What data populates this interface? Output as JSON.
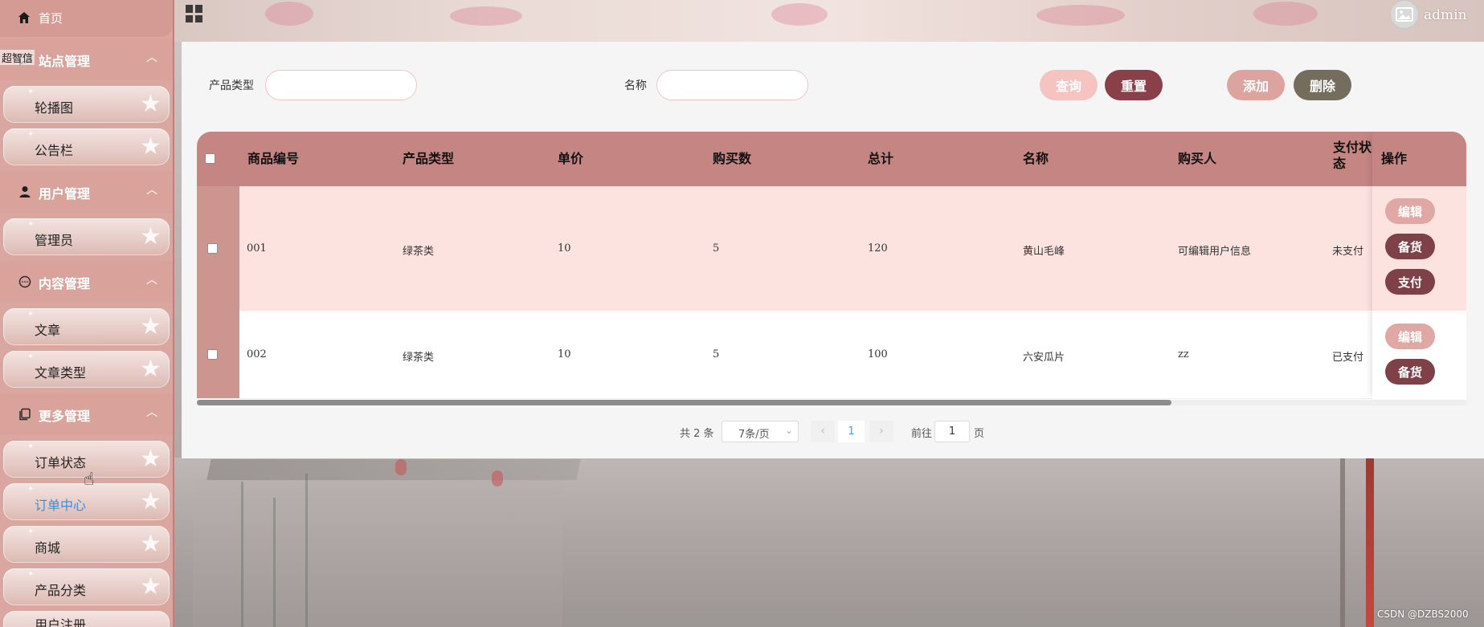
{
  "header": {
    "username": "admin"
  },
  "sidebar": {
    "home_label": "首页",
    "float_label": "超智信",
    "groups": [
      {
        "label": "站点管理",
        "icon": "chat-icon"
      },
      {
        "label": "用户管理",
        "icon": "user-icon"
      },
      {
        "label": "内容管理",
        "icon": "comment-icon"
      },
      {
        "label": "更多管理",
        "icon": "copy-icon"
      }
    ],
    "items": [
      {
        "label": "轮播图"
      },
      {
        "label": "公告栏"
      },
      {
        "label": "管理员"
      },
      {
        "label": "文章"
      },
      {
        "label": "文章类型"
      },
      {
        "label": "订单状态"
      },
      {
        "label": "订单中心"
      },
      {
        "label": "商城"
      },
      {
        "label": "产品分类"
      },
      {
        "label": "用户注册"
      }
    ]
  },
  "filters": {
    "type_label": "产品类型",
    "type_value": "",
    "name_label": "名称",
    "name_value": ""
  },
  "buttons": {
    "query": "查询",
    "reset": "重置",
    "add": "添加",
    "delete": "删除"
  },
  "table": {
    "headers": [
      "商品编号",
      "产品类型",
      "单价",
      "购买数",
      "总计",
      "名称",
      "购买人",
      "支付状态",
      "操作"
    ],
    "rows": [
      {
        "id": "001",
        "type": "绿茶类",
        "price": "10",
        "qty": "5",
        "total": "120",
        "name": "黄山毛峰",
        "buyer": "可编辑用户信息",
        "status": "未支付",
        "ops": [
          "编辑",
          "备货",
          "支付"
        ]
      },
      {
        "id": "002",
        "type": "绿茶类",
        "price": "10",
        "qty": "5",
        "total": "100",
        "name": "六安瓜片",
        "buyer": "zz",
        "status": "已支付",
        "ops": [
          "编辑",
          "备货"
        ]
      }
    ]
  },
  "pagination": {
    "total_text": "共 2 条",
    "page_size": "7条/页",
    "current_page": "1",
    "goto_prefix": "前往",
    "goto_value": "1",
    "goto_suffix": "页"
  },
  "watermark": "CSDN @DZBS2000",
  "colors": {
    "btn_query": "#f5c3c0",
    "btn_reset": "#8a4048",
    "btn_add": "#dda39f",
    "btn_delete": "#746d5e",
    "table_header": "#c58683"
  }
}
